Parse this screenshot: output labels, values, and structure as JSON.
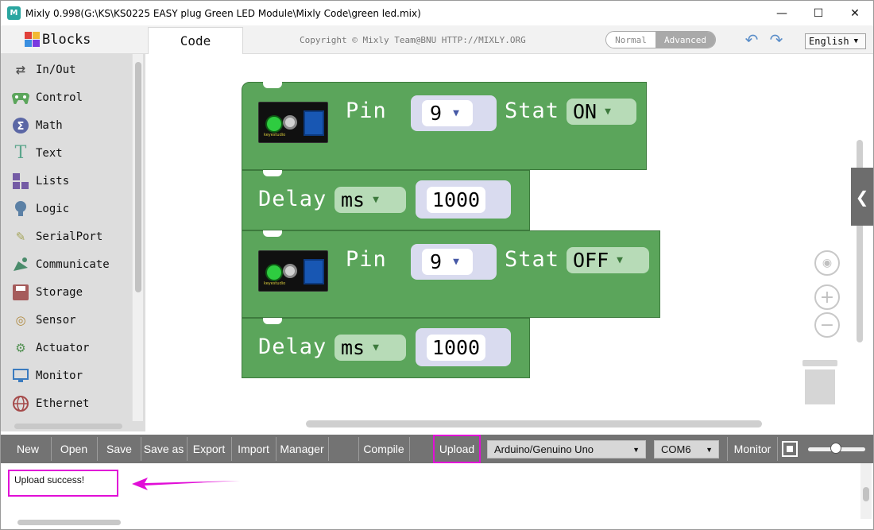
{
  "window": {
    "title": "Mixly 0.998(G:\\KS\\KS0225 EASY plug Green LED Module\\Mixly Code\\green led.mix)",
    "app_icon_text": "M",
    "minimize": "—",
    "maximize": "☐",
    "close": "✕"
  },
  "topbar": {
    "blocks_tab": "Blocks",
    "code_tab": "Code",
    "copyright": "Copyright © Mixly Team@BNU HTTP://MIXLY.ORG",
    "mode_normal": "Normal",
    "mode_advanced": "Advanced",
    "language": "English"
  },
  "sidebar": {
    "categories": [
      {
        "label": "In/Out",
        "icon": "arrows-icon",
        "color": "#555555",
        "glyph": "⇄"
      },
      {
        "label": "Control",
        "icon": "gamepad-icon",
        "color": "#5ba55b",
        "glyph": "🎮"
      },
      {
        "label": "Math",
        "icon": "math-icon",
        "color": "#5b67a5",
        "glyph": "Σ"
      },
      {
        "label": "Text",
        "icon": "text-icon",
        "color": "#5ba58c",
        "glyph": "T"
      },
      {
        "label": "Lists",
        "icon": "lists-icon",
        "color": "#745ba5",
        "glyph": "▚"
      },
      {
        "label": "Logic",
        "icon": "bulb-icon",
        "color": "#5b80a5",
        "glyph": "●"
      },
      {
        "label": "SerialPort",
        "icon": "pen-icon",
        "color": "#a5a55b",
        "glyph": "✎"
      },
      {
        "label": "Communicate",
        "icon": "satellite-icon",
        "color": "#4a8b6b",
        "glyph": "✈"
      },
      {
        "label": "Storage",
        "icon": "storage-icon",
        "color": "#a55b5b",
        "glyph": "▦"
      },
      {
        "label": "Sensor",
        "icon": "sensor-icon",
        "color": "#b08a40",
        "glyph": "◎"
      },
      {
        "label": "Actuator",
        "icon": "actuator-icon",
        "color": "#4f8f4f",
        "glyph": "⚙"
      },
      {
        "label": "Monitor",
        "icon": "monitor-icon",
        "color": "#3b7bbf",
        "glyph": "▭"
      },
      {
        "label": "Ethernet",
        "icon": "globe-icon",
        "color": "#a54a4a",
        "glyph": "⊕"
      }
    ]
  },
  "workspace": {
    "blocks": [
      {
        "label": "Pin",
        "pin": "9",
        "stat_label": "Stat",
        "stat": "ON"
      },
      {
        "label": "Delay",
        "unit": "ms",
        "value": "1000"
      },
      {
        "label": "Pin",
        "pin": "9",
        "stat_label": "Stat",
        "stat": "OFF"
      },
      {
        "label": "Delay",
        "unit": "ms",
        "value": "1000"
      }
    ],
    "board_label": "keyestudio"
  },
  "toolbar": {
    "new": "New",
    "open": "Open",
    "save": "Save",
    "save_as": "Save as",
    "export": "Export",
    "import": "Import",
    "manager": "Manager",
    "compile": "Compile",
    "upload": "Upload",
    "board": "Arduino/Genuino Uno",
    "port": "COM6",
    "monitor": "Monitor"
  },
  "output": {
    "message": "Upload success!"
  },
  "colors": {
    "block_green": "#5ba55b",
    "highlight_magenta": "#e10ed7",
    "toolbar_gray": "#737373"
  }
}
